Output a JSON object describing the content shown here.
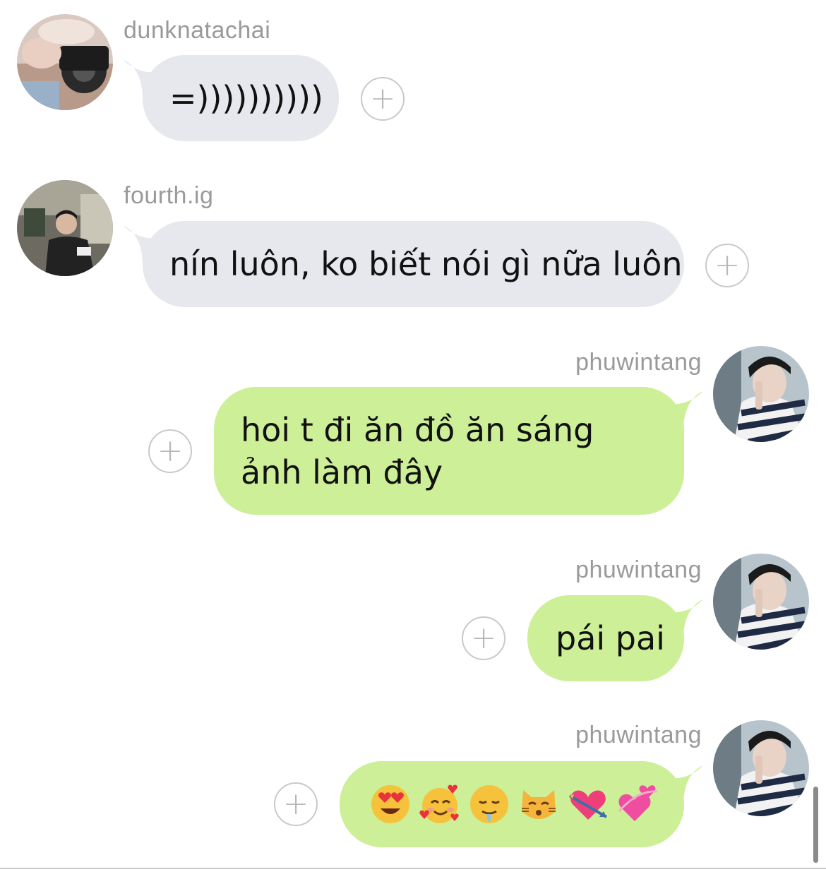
{
  "messages": [
    {
      "sender": "dunknatachai",
      "text": "=))))))))))",
      "direction": "incoming",
      "avatar": "avatar-camera-photo"
    },
    {
      "sender": "fourth.ig",
      "text": "nín luôn, ko biết nói gì nữa luôn",
      "direction": "incoming",
      "avatar": "avatar-room-photo"
    },
    {
      "sender": "phuwintang",
      "text": "hoi t đi ăn đồ ăn sáng ảnh làm đây",
      "direction": "outgoing",
      "avatar": "avatar-striped-shirt-photo"
    },
    {
      "sender": "phuwintang",
      "text": "pái pai",
      "direction": "outgoing",
      "avatar": "avatar-striped-shirt-photo"
    },
    {
      "sender": "phuwintang",
      "emojis": [
        "heart-eyes",
        "smiling-with-hearts",
        "drooling",
        "kissing-cat",
        "heart-with-arrow",
        "revolving-hearts"
      ],
      "direction": "outgoing",
      "avatar": "avatar-striped-shirt-photo"
    }
  ],
  "icons": {
    "react": "plus-circle-icon"
  },
  "colors": {
    "incoming_bubble": "#e6e8ed",
    "outgoing_bubble": "#ccef98",
    "sender_text": "#9a9a9a"
  },
  "ui": {
    "plus_glyph": "+"
  }
}
